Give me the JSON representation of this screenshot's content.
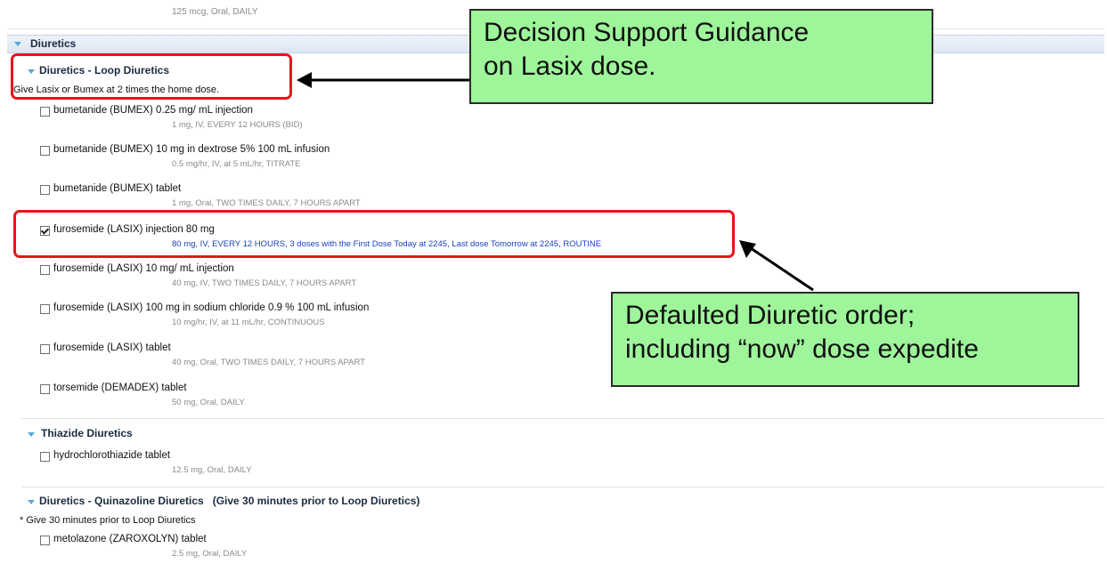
{
  "top_order_detail": "125 mcg, Oral, DAILY",
  "section": {
    "title": "Diuretics"
  },
  "loop": {
    "title": "Diuretics - Loop Diuretics",
    "note": "Give Lasix or Bumex at 2 times the home dose.",
    "orders": [
      {
        "name": "bumetanide (BUMEX) 0.25 mg/ mL injection",
        "detail": "1 mg, IV, EVERY 12 HOURS (BID)",
        "checked": false
      },
      {
        "name": "bumetanide (BUMEX) 10 mg in dextrose 5% 100 mL infusion",
        "detail": "0.5 mg/hr, IV, at 5 mL/hr, TITRATE",
        "checked": false
      },
      {
        "name": "bumetanide (BUMEX) tablet",
        "detail": "1 mg, Oral, TWO TIMES DAILY, 7 HOURS APART",
        "checked": false
      },
      {
        "name": "furosemide (LASIX) injection 80 mg",
        "detail": "80 mg, IV, EVERY 12 HOURS, 3 doses with the First Dose Today at 2245, Last dose Tomorrow at 2245, ROUTINE",
        "checked": true
      },
      {
        "name": "furosemide (LASIX) 10 mg/ mL injection",
        "detail": "40 mg, IV, TWO TIMES DAILY, 7 HOURS APART",
        "checked": false
      },
      {
        "name": "furosemide (LASIX) 100 mg in sodium chloride 0.9 % 100 mL infusion",
        "detail": "10 mg/hr, IV, at 11 mL/hr, CONTINUOUS",
        "checked": false
      },
      {
        "name": "furosemide (LASIX) tablet",
        "detail": "40 mg, Oral, TWO TIMES DAILY, 7 HOURS APART",
        "checked": false
      },
      {
        "name": "torsemide (DEMADEX) tablet",
        "detail": "50 mg, Oral, DAILY",
        "checked": false
      }
    ]
  },
  "thiazide": {
    "title": "Thiazide Diuretics",
    "orders": [
      {
        "name": "hydrochlorothiazide tablet",
        "detail": "12.5 mg, Oral, DAILY",
        "checked": false
      }
    ]
  },
  "quinazoline": {
    "title": "Diuretics - Quinazoline Diuretics   (Give 30 minutes prior to Loop Diuretics)",
    "note": "* Give 30 minutes prior to Loop Diuretics",
    "orders": [
      {
        "name": "metolazone (ZAROXOLYN) tablet",
        "detail": "2.5 mg, Oral, DAILY",
        "checked": false
      }
    ]
  },
  "callouts": {
    "decision_support": [
      "Decision Support Guidance",
      "on Lasix dose."
    ],
    "defaulted_order": [
      "Defaulted Diuretic order;",
      "including “now” dose expedite"
    ]
  },
  "colors": {
    "callout_bg": "#9ef59a",
    "highlight_box": "#e8141c",
    "selected_detail": "#1a3fbf",
    "twisty": "#5aa6d6"
  }
}
